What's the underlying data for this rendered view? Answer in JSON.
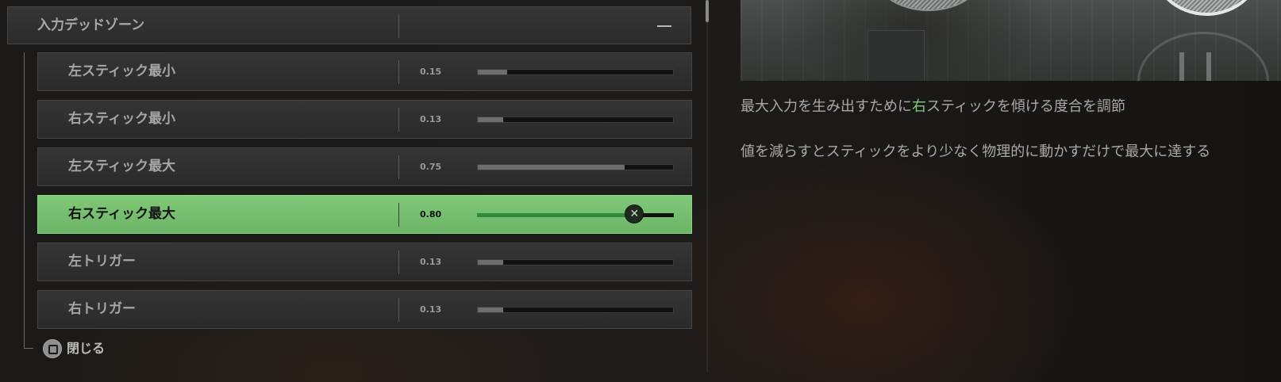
{
  "group": {
    "title": "入力デッドゾーン",
    "collapse_icon": "minus-icon"
  },
  "settings": [
    {
      "label": "左スティック最小",
      "value": "0.15",
      "level": 0.15,
      "focused": false
    },
    {
      "label": "右スティック最小",
      "value": "0.13",
      "level": 0.13,
      "focused": false
    },
    {
      "label": "左スティック最大",
      "value": "0.75",
      "level": 0.75,
      "focused": false
    },
    {
      "label": "右スティック最大",
      "value": "0.80",
      "level": 0.8,
      "focused": true
    },
    {
      "label": "左トリガー",
      "value": "0.13",
      "level": 0.13,
      "focused": false
    },
    {
      "label": "右トリガー",
      "value": "0.13",
      "level": 0.13,
      "focused": false
    }
  ],
  "footer": {
    "close_label": "閉じる",
    "close_icon": "square-button-icon"
  },
  "description": {
    "line1_before": "最大入力を生み出すために",
    "line1_highlight": "右",
    "line1_after": "スティックを傾ける度合を調節",
    "line2": "値を減らすとスティックをより少なく物理的に動かすだけで最大に達する"
  },
  "colors": {
    "focus_green": "#7bc274",
    "highlight_text": "#7fc97a",
    "slider_fill_focused": "#2e8a3c"
  }
}
